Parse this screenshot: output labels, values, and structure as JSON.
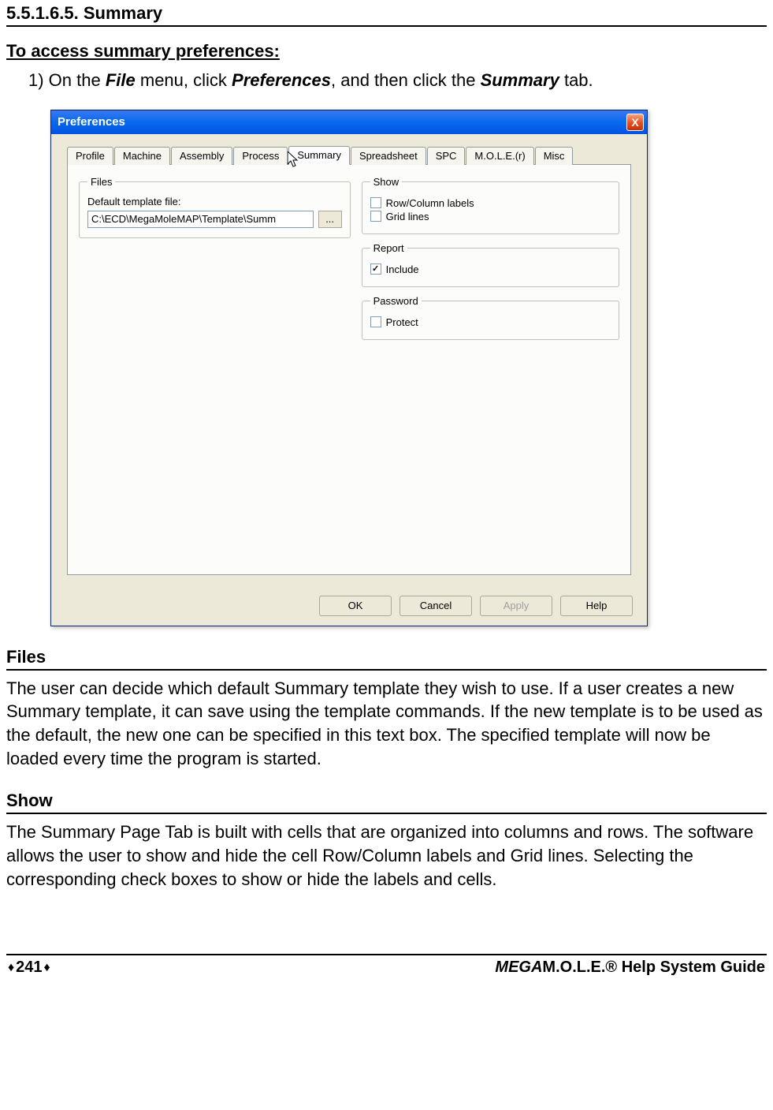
{
  "heading_number": "5.5.1.6.5. Summary",
  "access_heading": "To access summary preferences:",
  "step_prefix": "1) On the ",
  "step_file": "File",
  "step_mid1": " menu, click ",
  "step_prefs": "Preferences",
  "step_mid2": ", and then click the ",
  "step_summary": "Summary",
  "step_suffix": " tab.",
  "dialog": {
    "title": "Preferences",
    "close_x": "X",
    "tabs": {
      "profile": "Profile",
      "machine": "Machine",
      "assembly": "Assembly",
      "process": "Process",
      "summary": "Summary",
      "spreadsheet": "Spreadsheet",
      "spc": "SPC",
      "mole": "M.O.L.E.(r)",
      "misc": "Misc"
    },
    "files": {
      "legend": "Files",
      "label": "Default template file:",
      "value": "C:\\ECD\\MegaMoleMAP\\Template\\Summ",
      "browse": "..."
    },
    "show": {
      "legend": "Show",
      "rowcol": "Row/Column labels",
      "grid": "Grid lines"
    },
    "report": {
      "legend": "Report",
      "include": "Include"
    },
    "password": {
      "legend": "Password",
      "protect": "Protect"
    },
    "buttons": {
      "ok": "OK",
      "cancel": "Cancel",
      "apply": "Apply",
      "help": "Help"
    }
  },
  "files_heading": "Files",
  "files_para": "The user can decide which default Summary template they wish to use. If a user creates a new Summary template, it can save using the template commands. If the new template is to be used as the default, the new one can be specified in this text box. The specified template will now be loaded every time the program is started.",
  "show_heading": "Show",
  "show_para": "The Summary Page Tab is built with cells that are organized into columns and rows. The software allows the user to show and hide the cell Row/Column labels and Grid lines. Selecting the corresponding check boxes to show or hide the labels and cells.",
  "footer": {
    "page": "241",
    "diamond": "♦",
    "guide_italic_part": "MEGA",
    "guide_rest": "M.O.L.E.® Help System Guide"
  }
}
